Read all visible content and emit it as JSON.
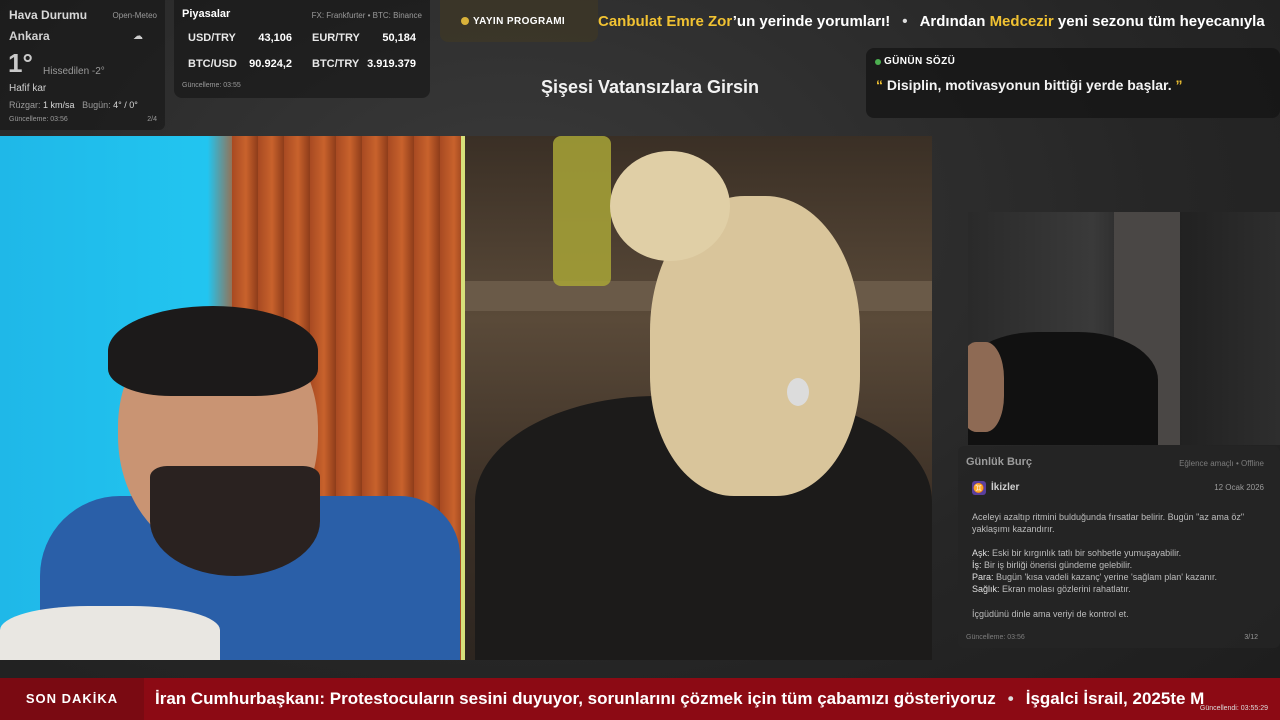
{
  "weather": {
    "title": "Hava Durumu",
    "source": "Open-Meteo",
    "city": "Ankara",
    "temp": "1°",
    "feels": "Hissedilen -2°",
    "condition": "Hafif kar",
    "wind_label": "Rüzgar:",
    "wind_value": "1 km/sa",
    "today_label": "Bugün:",
    "today_value": "4° / 0°",
    "updated": "Güncelleme: 03:56",
    "page": "2/4"
  },
  "markets": {
    "title": "Piyasalar",
    "source": "FX: Frankfurter • BTC: Binance",
    "rows": [
      {
        "name": "USD/TRY",
        "value": "43,106"
      },
      {
        "name": "EUR/TRY",
        "value": "50,184"
      },
      {
        "name": "BTC/USD",
        "value": "90.924,2"
      },
      {
        "name": "BTC/TRY",
        "value": "3.919.379"
      }
    ],
    "updated": "Güncelleme: 03:55"
  },
  "schedule": {
    "label": "YAYIN PROGRAMI"
  },
  "top_ticker": {
    "name1": "Canbulat Emre Zor",
    "text1": "’un yerinde yorumları!",
    "text2": "Ardından ",
    "name2": "Medcezir",
    "text3": " yeni sezonu tüm heyecanıyla"
  },
  "show_title": "Şişesi Vatansızlara Girsin",
  "quote": {
    "label": "GÜNÜN SÖZÜ",
    "open": "“",
    "text": " Disiplin, motivasyonun bittiği yerde başlar. ",
    "close": "”"
  },
  "horoscope": {
    "title": "Günlük Burç",
    "note": "Eğlence amaçlı • Offline",
    "sign": "İkizler",
    "date": "12 Ocak 2026",
    "intro": "Aceleyi azaltıp ritmini bulduğunda fırsatlar belirir. Bugün \"az ama öz\" yaklaşımı kazandırır.",
    "love_label": "Aşk:",
    "love": " Eski bir kırgınlık tatlı bir sohbetle yumuşayabilir.",
    "work_label": "İş:",
    "work": " Bir iş birliği önerisi gündeme gelebilir.",
    "money_label": "Para:",
    "money": " Bugün 'kısa vadeli kazanç' yerine 'sağlam plan' kazanır.",
    "health_label": "Sağlık:",
    "health": " Ekran molası gözlerini rahatlatır.",
    "advice": "İçgüdünü dinle ama veriyi de kontrol et.",
    "updated": "Güncelleme: 03:56",
    "page": "3/12"
  },
  "breaking": {
    "label": "SON DAKİKA",
    "text1": "İran Cumhurbaşkanı: Protestocuların sesini duyuyor, sorunlarını çözmek için tüm çabamızı gösteriyoruz",
    "text2": "İşgalci İsrail, 2025te M",
    "updated": "Güncellendi: 03:55:29"
  },
  "colors": {
    "accent": "#f1c232",
    "breaking_bg": "#8c0a14",
    "live_dot": "#4caf50"
  }
}
